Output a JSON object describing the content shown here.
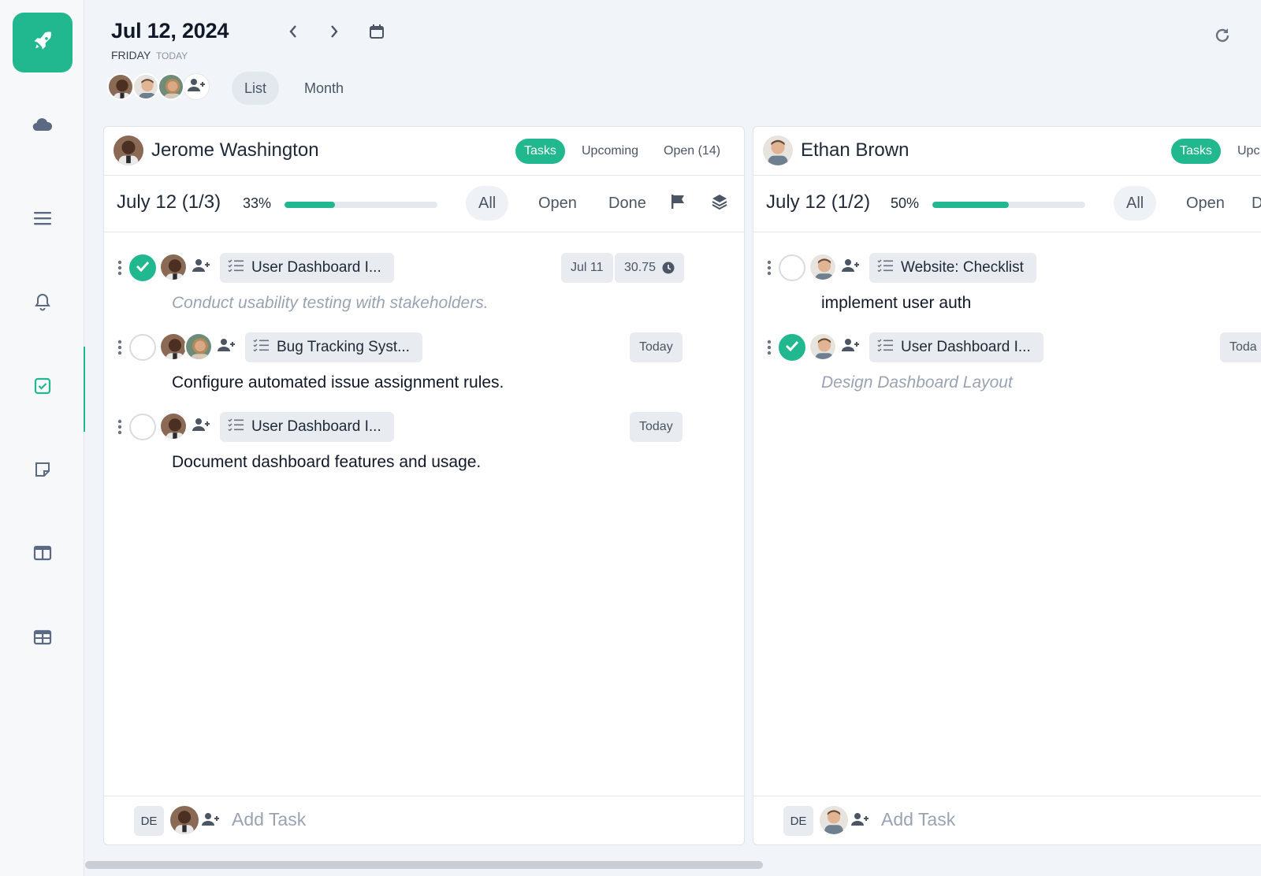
{
  "header": {
    "date": "Jul 12, 2024",
    "day": "FRIDAY",
    "today": "TODAY",
    "views": [
      {
        "label": "List",
        "active": true
      },
      {
        "label": "Month",
        "active": false
      }
    ]
  },
  "sidebar": {
    "items": [
      {
        "icon": "cloud-icon",
        "active": false
      },
      {
        "icon": "menu-icon",
        "active": false
      },
      {
        "icon": "bell-icon",
        "active": false
      },
      {
        "icon": "checkbox-icon",
        "active": true
      },
      {
        "icon": "note-icon",
        "active": false
      },
      {
        "icon": "columns-icon",
        "active": false
      },
      {
        "icon": "table-icon",
        "active": false
      }
    ]
  },
  "colors": {
    "accent": "#21b890",
    "background": "#f1f4f8"
  },
  "columns": [
    {
      "name": "Jerome Washington",
      "tabs": [
        "Tasks",
        "Upcoming",
        "Open (14)"
      ],
      "date": "July 12 (1/3)",
      "percent": "33%",
      "progress": 0.33,
      "filters": [
        "All",
        "Open",
        "Done"
      ],
      "tasks": [
        {
          "done": true,
          "project": "User Dashboard I...",
          "meta": [
            "Jul 11",
            "30.75"
          ],
          "text": "Conduct usability testing with stakeholders.",
          "muted": true
        },
        {
          "done": false,
          "project": "Bug Tracking Syst...",
          "meta": [
            "Today"
          ],
          "text": "Configure automated issue assignment rules.",
          "muted": false
        },
        {
          "done": false,
          "project": "User Dashboard I...",
          "meta": [
            "Today"
          ],
          "text": "Document dashboard features and usage.",
          "muted": false
        }
      ],
      "footer": {
        "badge": "DE",
        "add_task": "Add Task"
      }
    },
    {
      "name": "Ethan Brown",
      "tabs": [
        "Tasks",
        "Upc"
      ],
      "date": "July 12 (1/2)",
      "percent": "50%",
      "progress": 0.5,
      "filters": [
        "All",
        "Open",
        "D"
      ],
      "tasks": [
        {
          "done": false,
          "project": "Website: Checklist",
          "meta": [],
          "text": "implement user auth",
          "muted": false
        },
        {
          "done": true,
          "project": "User Dashboard I...",
          "meta": [
            "Toda"
          ],
          "text": "Design Dashboard Layout",
          "muted": true
        }
      ],
      "footer": {
        "badge": "DE",
        "add_task": "Add Task"
      }
    }
  ]
}
